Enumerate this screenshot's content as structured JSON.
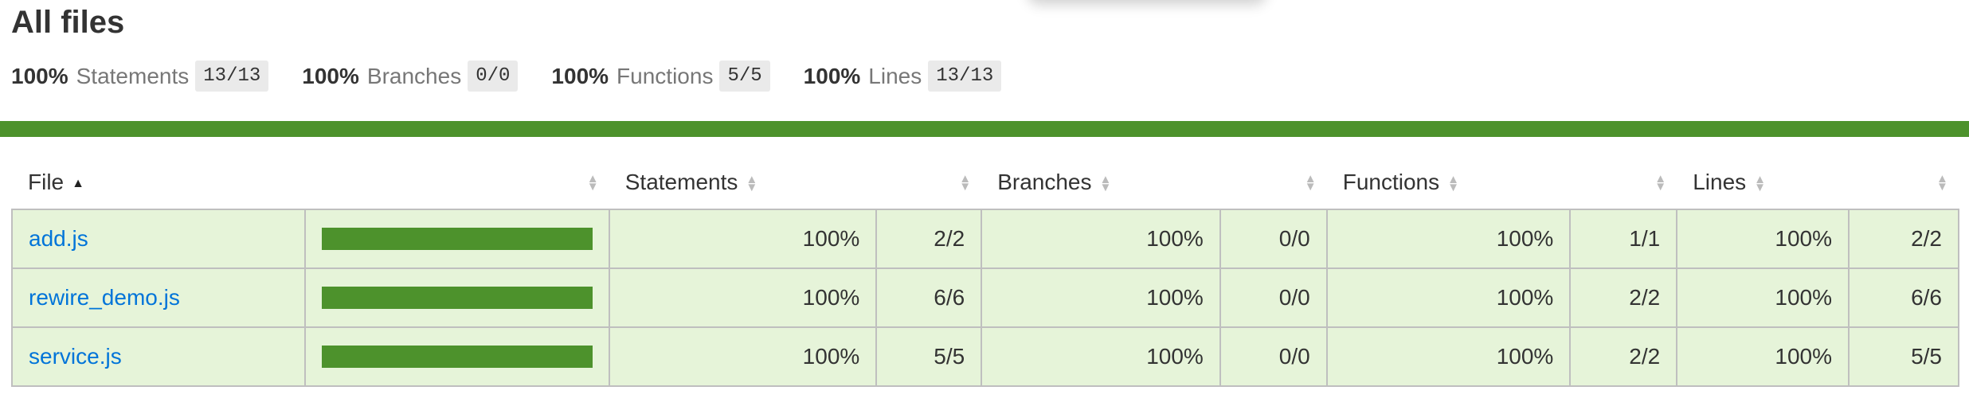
{
  "header": {
    "title": "All files"
  },
  "summary": [
    {
      "pct": "100%",
      "label": "Statements",
      "fraction": "13/13"
    },
    {
      "pct": "100%",
      "label": "Branches",
      "fraction": "0/0"
    },
    {
      "pct": "100%",
      "label": "Functions",
      "fraction": "5/5"
    },
    {
      "pct": "100%",
      "label": "Lines",
      "fraction": "13/13"
    }
  ],
  "status": {
    "level": "high",
    "color": "#4d922c"
  },
  "table": {
    "columns": {
      "file": "File",
      "statements": "Statements",
      "branches": "Branches",
      "functions": "Functions",
      "lines": "Lines"
    },
    "rows": [
      {
        "file": "add.js",
        "coverage_fraction": 1.0,
        "statements_pct": "100%",
        "statements": "2/2",
        "branches_pct": "100%",
        "branches": "0/0",
        "functions_pct": "100%",
        "functions": "1/1",
        "lines_pct": "100%",
        "lines": "2/2"
      },
      {
        "file": "rewire_demo.js",
        "coverage_fraction": 1.0,
        "statements_pct": "100%",
        "statements": "6/6",
        "branches_pct": "100%",
        "branches": "0/0",
        "functions_pct": "100%",
        "functions": "2/2",
        "lines_pct": "100%",
        "lines": "6/6"
      },
      {
        "file": "service.js",
        "coverage_fraction": 1.0,
        "statements_pct": "100%",
        "statements": "5/5",
        "branches_pct": "100%",
        "branches": "0/0",
        "functions_pct": "100%",
        "functions": "2/2",
        "lines_pct": "100%",
        "lines": "5/5"
      }
    ]
  },
  "icons": {
    "sort_asc": "sort-ascending-icon",
    "sort_both": "sort-icon"
  },
  "colors": {
    "coverage_high": "#4d922c",
    "row_bg": "#e6f4d9",
    "link": "#0074d9"
  }
}
